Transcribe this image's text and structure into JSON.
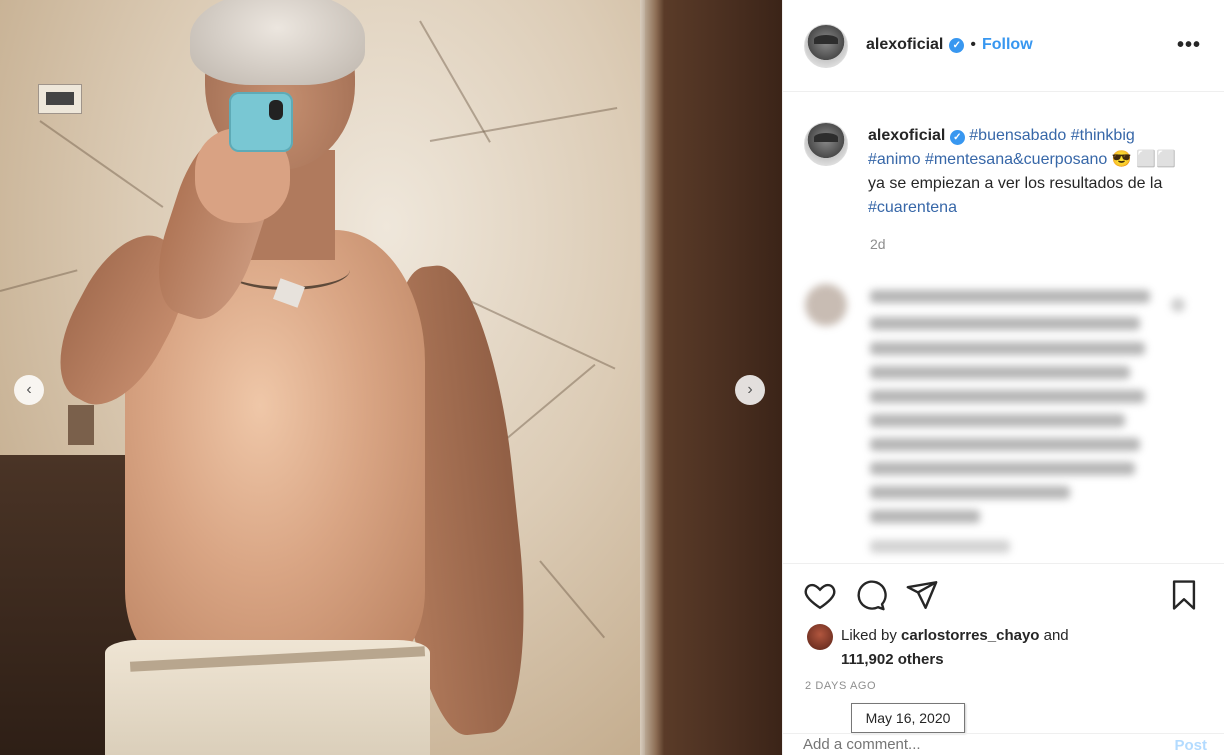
{
  "header": {
    "username": "alexoficial",
    "verified_mark": "✓",
    "separator": "•",
    "follow_label": "Follow",
    "more_label": "•••"
  },
  "media": {
    "prev_arrow": "‹",
    "next_arrow": "›"
  },
  "caption": {
    "username": "alexoficial",
    "parts": [
      {
        "text": "#buensabado",
        "type": "tag"
      },
      {
        "text": " ",
        "type": "plain"
      },
      {
        "text": "#thinkbig",
        "type": "tag"
      },
      {
        "text": " ",
        "type": "plain"
      },
      {
        "text": "#animo",
        "type": "tag"
      },
      {
        "text": " ",
        "type": "plain"
      },
      {
        "text": "#mentesana&cuerposano",
        "type": "tag"
      },
      {
        "text": " 😎 ",
        "type": "plain"
      },
      {
        "text": "⬜⬜ ya se empiezan a ver los resultados de la ",
        "type": "plain"
      },
      {
        "text": "#cuarentena",
        "type": "tag"
      }
    ],
    "time": "2d"
  },
  "actions": {
    "like_icon": "heart-icon",
    "comment_icon": "comment-icon",
    "share_icon": "share-icon",
    "save_icon": "bookmark-icon"
  },
  "likes": {
    "prefix": "Liked by ",
    "user": "carlostorres_chayo",
    "middle": " and",
    "count": "111,902 others"
  },
  "posted": {
    "relative": "2 DAYS AGO",
    "tooltip": "May 16, 2020"
  },
  "comment": {
    "placeholder": "Add a comment...",
    "post_label": "Post"
  },
  "colors": {
    "accent": "#3897f0",
    "hashtag": "#3767a8",
    "muted": "#8e8e8e"
  }
}
